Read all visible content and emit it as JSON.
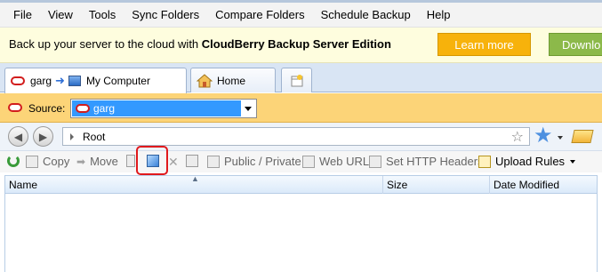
{
  "menu": [
    "File",
    "View",
    "Tools",
    "Sync Folders",
    "Compare Folders",
    "Schedule Backup",
    "Help"
  ],
  "promo": {
    "text": "Back up your server to the cloud with ",
    "product": "CloudBerry Backup Server Edition",
    "learn_more": "Learn more",
    "download": "Downlo"
  },
  "tabs": {
    "main_source": "garg",
    "main_dest": "My Computer",
    "home": "Home"
  },
  "source": {
    "label": "Source:",
    "value": "garg"
  },
  "address": {
    "path": "Root"
  },
  "toolbar": {
    "copy": "Copy",
    "move": "Move",
    "public_private": "Public / Private",
    "web_url": "Web URL",
    "set_http_headers": "Set HTTP Headers",
    "upload_rules": "Upload Rules"
  },
  "columns": {
    "name": "Name",
    "size": "Size",
    "date_modified": "Date Modified"
  },
  "colors": {
    "promo_bg": "#fefdde",
    "learn_more": "#f7b20b",
    "download": "#8cb94a",
    "source_bar": "#fcd478",
    "selection": "#3399ff",
    "highlight": "#e0191c"
  }
}
